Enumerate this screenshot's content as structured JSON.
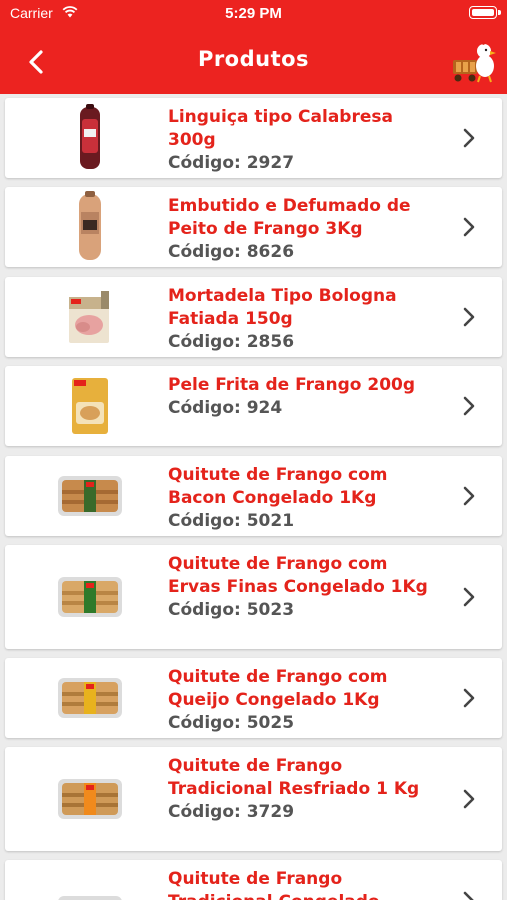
{
  "status": {
    "carrier": "Carrier",
    "time": "5:29 PM"
  },
  "nav": {
    "title": "Produtos",
    "back_icon": "chevron-left-icon",
    "logo_icon": "chicken-mascot-logo"
  },
  "products": [
    {
      "name": "Linguiça tipo Calabresa 300g",
      "code_label": "Código: 2927"
    },
    {
      "name": "Embutido e Defumado de Peito de Frango 3Kg",
      "code_label": "Código: 8626"
    },
    {
      "name": "Mortadela Tipo Bologna Fatiada 150g",
      "code_label": "Código: 2856"
    },
    {
      "name": "Pele Frita de Frango 200g",
      "code_label": "Código: 924"
    },
    {
      "name": "Quitute de Frango com Bacon Congelado 1Kg",
      "code_label": "Código: 5021"
    },
    {
      "name": "Quitute de Frango com Ervas Finas Congelado 1Kg",
      "code_label": "Código: 5023"
    },
    {
      "name": "Quitute de Frango com Queijo Congelado 1Kg",
      "code_label": "Código: 5025"
    },
    {
      "name": "Quitute de Frango Tradicional Resfriado 1 Kg",
      "code_label": "Código: 3729"
    },
    {
      "name": "Quitute de Frango Tradicional Congelado",
      "code_label": ""
    }
  ],
  "colors": {
    "brand_red": "#ec2320",
    "name_red": "#e4231b",
    "code_gray": "#555555",
    "background": "#ececec"
  }
}
